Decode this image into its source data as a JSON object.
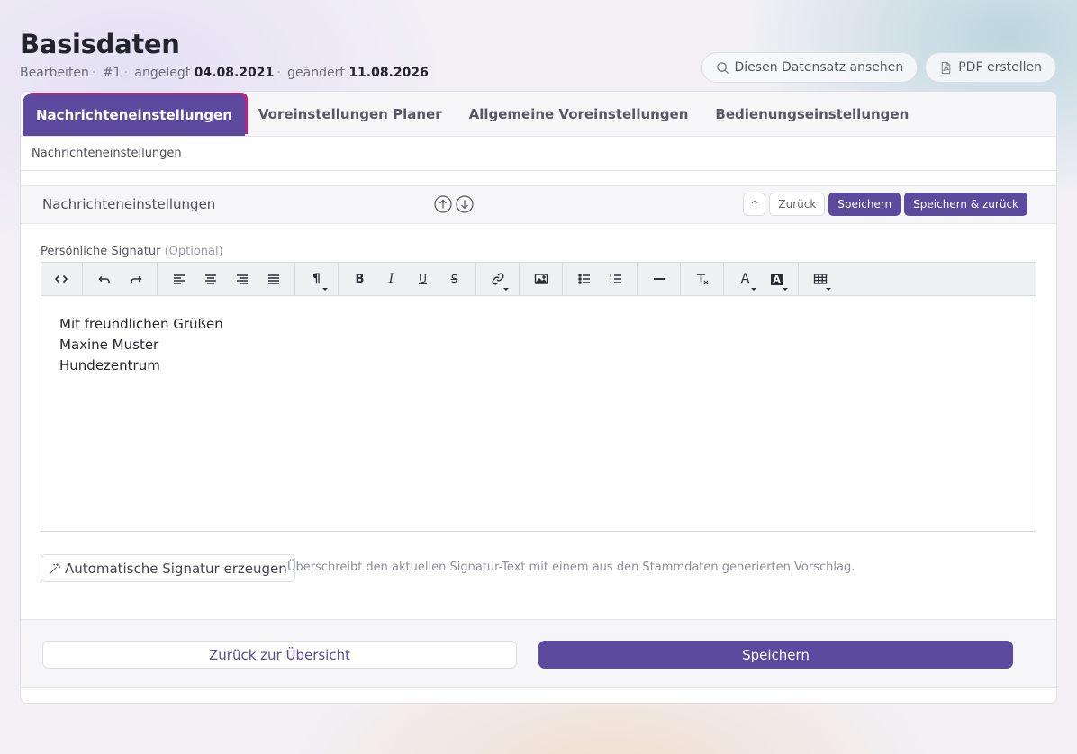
{
  "header": {
    "title": "Basisdaten",
    "mode": "Bearbeiten",
    "record_id": "#1",
    "created_label": "angelegt",
    "created_date": "04.08.2021",
    "changed_label": "geändert",
    "changed_date": "11.08.2026"
  },
  "top_actions": {
    "view_label": "Diesen Datensatz ansehen",
    "pdf_label": "PDF erstellen"
  },
  "tabs": [
    {
      "label": "Nachrichteneinstellungen",
      "active": true
    },
    {
      "label": "Voreinstellungen Planer",
      "active": false
    },
    {
      "label": "Allgemeine Voreinstellungen",
      "active": false
    },
    {
      "label": "Bedienungseinstellungen",
      "active": false
    }
  ],
  "breadcrumb": "Nachrichteneinstellungen",
  "section": {
    "title": "Nachrichteneinstellungen",
    "up_label": "^",
    "back_label": "Zurück",
    "save_label": "Speichern",
    "save_back_label": "Speichern & zurück"
  },
  "signature": {
    "label": "Persönliche Signatur",
    "optional": "(Optional)",
    "lines": [
      "Mit freundlichen Grüßen",
      "Maxine Muster",
      "Hundezentrum"
    ]
  },
  "toolbar": {
    "bold": "B",
    "italic": "I",
    "underline": "U",
    "strike": "S",
    "paragraph": "¶",
    "font_color": "A",
    "bg_color": "A"
  },
  "auto_signature": {
    "button_label": "Automatische Signatur erzeugen",
    "hint": "Überschreibt den aktuellen Signatur-Text mit einem aus den Stammdaten generierten Vorschlag."
  },
  "footer": {
    "back_label": "Zurück zur Übersicht",
    "save_label": "Speichern"
  },
  "colors": {
    "accent": "#5b4a9e",
    "tab_highlight": "#c41f86"
  }
}
